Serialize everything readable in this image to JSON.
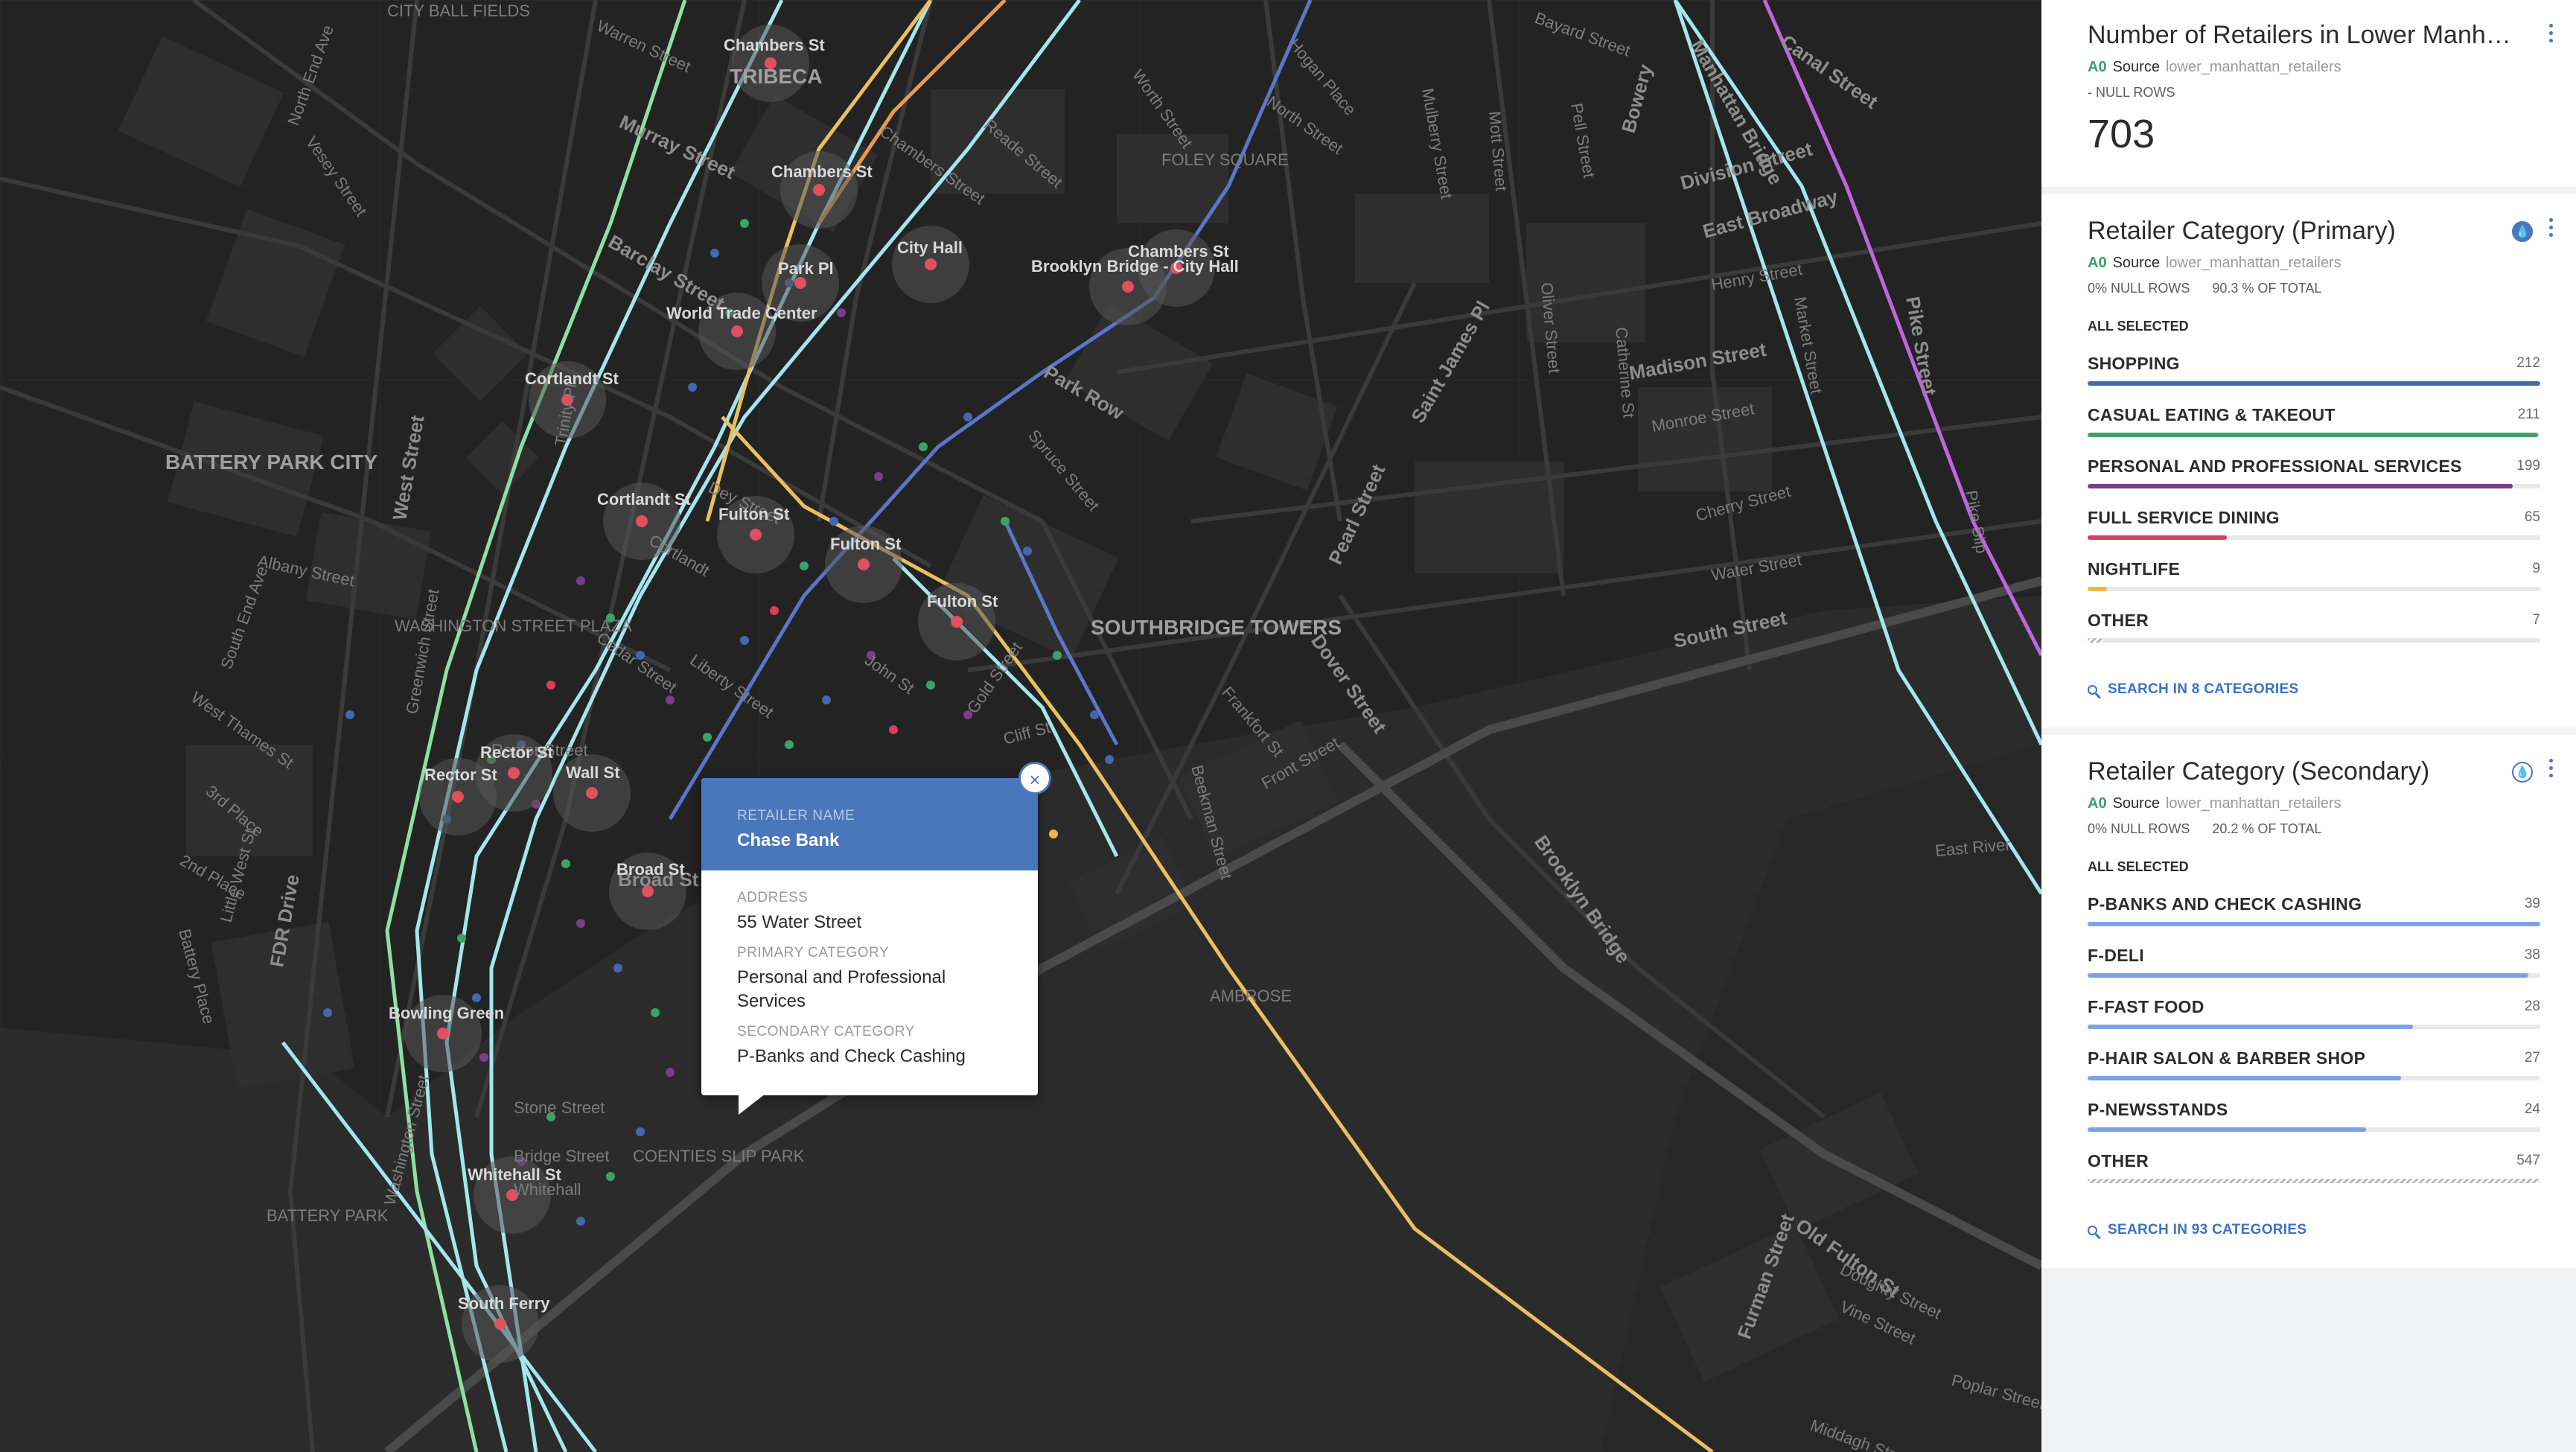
{
  "map": {
    "neighborhoods": [
      "BATTERY PARK CITY",
      "TRIBECA",
      "SOUTHBRIDGE TOWERS",
      "WASHINGTON STREET PLAZA",
      "FOLEY SQUARE",
      "BATTERY PARK",
      "AMBROSE",
      "COENTIES SLIP PARK",
      "CITY BALL FIELDS"
    ],
    "streets": [
      "Murray Street",
      "Warren Street",
      "Chambers Street",
      "Barclay Street",
      "West Street",
      "Albany Street",
      "FDR Drive",
      "South Street",
      "Water Street",
      "Pearl Street",
      "Madison Street",
      "Canal Street",
      "East Broadway",
      "Division Street",
      "Brooklyn Bridge",
      "Park Row",
      "Cherry Street",
      "Monroe Street",
      "East River",
      "Old Fulton St",
      "Pike Street",
      "Catherine St",
      "Oliver Street",
      "Bowery",
      "Henry Street",
      "Broad St",
      "Liberty Street",
      "Cedar Street",
      "John St",
      "Gold Street",
      "Spruce Street",
      "Frankfort St",
      "Dover Street",
      "Beekman Street",
      "Front Street",
      "Saint James Pl",
      "Market Street",
      "Pell Street",
      "Mott Street",
      "Bayard Street",
      "Mulberry Street",
      "Hogan Place",
      "North Street",
      "Worth Street",
      "Reade Street",
      "Stone Street",
      "Bridge Street",
      "Whitehall",
      "Rector Street",
      "Greenwich Street",
      "Trinity Pl",
      "Washington Street",
      "Battery Place",
      "2nd Place",
      "3rd Place",
      "Little West St",
      "West Thames St",
      "South End Ave",
      "North End Ave",
      "Vesey Street",
      "Poplar Street",
      "Doughty Street",
      "Vine Street",
      "Furman Street",
      "Middagh Street",
      "Dey Street",
      "Cortlandt",
      "Cliff St",
      "Pike Slip",
      "Manhattan Bridge"
    ],
    "stations": [
      "Chambers St",
      "Chambers St",
      "Park Pl",
      "City Hall",
      "Chambers St",
      "Brooklyn Bridge - City Hall",
      "World Trade Center",
      "Cortlandt St",
      "Cortlandt St",
      "Fulton St",
      "Fulton St",
      "Fulton St",
      "Rector St",
      "Rector St",
      "Wall St",
      "Broad St",
      "Bowling Green",
      "Whitehall St",
      "South Ferry"
    ]
  },
  "popup": {
    "retailer_name_label": "RETAILER NAME",
    "retailer_name": "Chase Bank",
    "address_label": "ADDRESS",
    "address": "55 Water Street",
    "primary_label": "PRIMARY CATEGORY",
    "primary": "Personal and Professional Services",
    "secondary_label": "SECONDARY CATEGORY",
    "secondary": "P-Banks and Check Cashing",
    "close_glyph": "×"
  },
  "widgets": {
    "count": {
      "title": "Number of Retailers in Lower Manhattan",
      "source_tag": "A0",
      "source_label": "Source",
      "source_name": "lower_manhattan_retailers",
      "null_rows": "- NULL ROWS",
      "value": "703"
    },
    "primary": {
      "title": "Retailer Category (Primary)",
      "source_tag": "A0",
      "source_label": "Source",
      "source_name": "lower_manhattan_retailers",
      "null_rows": "0% NULL ROWS",
      "total": "90.3 % OF TOTAL",
      "all_selected": "ALL SELECTED",
      "categories": [
        {
          "name": "SHOPPING",
          "count": "212",
          "fraction": 1.0,
          "color": "#4367b0"
        },
        {
          "name": "CASUAL EATING & TAKEOUT",
          "count": "211",
          "fraction": 0.995,
          "color": "#3aa36b"
        },
        {
          "name": "PERSONAL AND PROFESSIONAL SERVICES",
          "count": "199",
          "fraction": 0.939,
          "color": "#7a3d8a"
        },
        {
          "name": "FULL SERVICE DINING",
          "count": "65",
          "fraction": 0.307,
          "color": "#d9405c"
        },
        {
          "name": "NIGHTLIFE",
          "count": "9",
          "fraction": 0.042,
          "color": "#e8b84a"
        },
        {
          "name": "OTHER",
          "count": "7",
          "fraction": 0.033,
          "color": "hatch"
        }
      ],
      "search": "SEARCH IN 8 CATEGORIES"
    },
    "secondary": {
      "title": "Retailer Category (Secondary)",
      "source_tag": "A0",
      "source_label": "Source",
      "source_name": "lower_manhattan_retailers",
      "null_rows": "0% NULL ROWS",
      "total": "20.2 % OF TOTAL",
      "all_selected": "ALL SELECTED",
      "categories": [
        {
          "name": "P-BANKS AND CHECK CASHING",
          "count": "39",
          "fraction": 1.0,
          "color": "#7ba2e8"
        },
        {
          "name": "F-DELI",
          "count": "38",
          "fraction": 0.974,
          "color": "#7ba2e8"
        },
        {
          "name": "F-FAST FOOD",
          "count": "28",
          "fraction": 0.718,
          "color": "#7ba2e8"
        },
        {
          "name": "P-HAIR SALON & BARBER SHOP",
          "count": "27",
          "fraction": 0.692,
          "color": "#7ba2e8"
        },
        {
          "name": "P-NEWSSTANDS",
          "count": "24",
          "fraction": 0.615,
          "color": "#7ba2e8"
        },
        {
          "name": "OTHER",
          "count": "547",
          "fraction": 1.0,
          "color": "hatch"
        }
      ],
      "search": "SEARCH IN 93 CATEGORIES"
    }
  }
}
